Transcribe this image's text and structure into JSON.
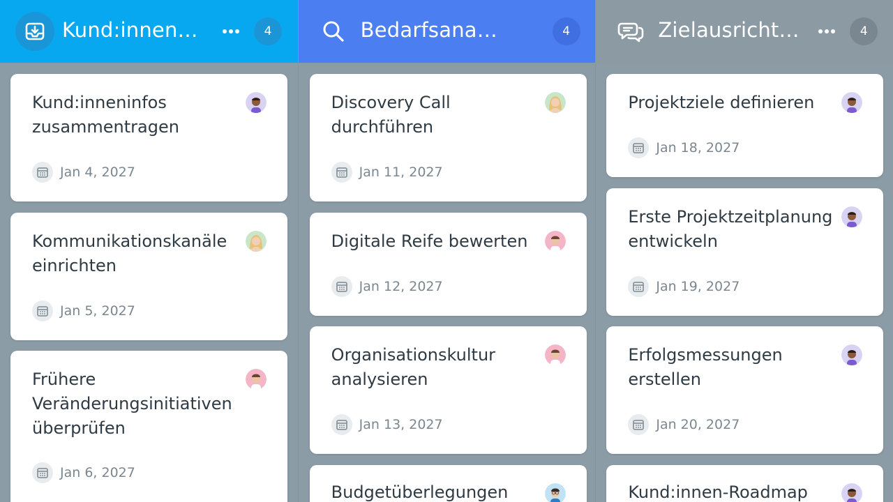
{
  "columns": [
    {
      "title": "Kund:innen…",
      "count": "4",
      "icon": "inbox-download-icon",
      "color": "#08a8f0",
      "cards": [
        {
          "title": "Kund:inneninfos zusammentragen",
          "date": "Jan 4, 2027",
          "avatar": "avatar-purple-man"
        },
        {
          "title": "Kommunikationskanäle einrichten",
          "date": "Jan 5, 2027",
          "avatar": "avatar-blonde-woman"
        },
        {
          "title": "Frühere Veränderungsinitiativen überprüfen",
          "date": "Jan 6, 2027",
          "avatar": "avatar-pink-man"
        }
      ]
    },
    {
      "title": "Bedarfsana…",
      "count": "4",
      "icon": "search-icon",
      "color": "#4b7ff1",
      "cards": [
        {
          "title": "Discovery Call durchführen",
          "date": "Jan 11, 2027",
          "avatar": "avatar-blonde-woman"
        },
        {
          "title": "Digitale Reife bewerten",
          "date": "Jan 12, 2027",
          "avatar": "avatar-pink-man"
        },
        {
          "title": "Organisationskultur analysieren",
          "date": "Jan 13, 2027",
          "avatar": "avatar-pink-man"
        },
        {
          "title": "Budgetüberlegungen",
          "date": "",
          "avatar": "avatar-blue-man"
        }
      ]
    },
    {
      "title": "Zielausricht…",
      "count": "4",
      "icon": "chat-bubbles-icon",
      "color": "#8c9aa3",
      "cards": [
        {
          "title": "Projektziele definieren",
          "date": "Jan 18, 2027",
          "avatar": "avatar-purple-man"
        },
        {
          "title": "Erste Projektzeitplanung entwickeln",
          "date": "Jan 19, 2027",
          "avatar": "avatar-purple-man"
        },
        {
          "title": "Erfolgsmessungen erstellen",
          "date": "Jan 20, 2027",
          "avatar": "avatar-purple-man"
        },
        {
          "title": "Kund:innen-Roadmap",
          "date": "",
          "avatar": "avatar-purple-man"
        }
      ]
    }
  ]
}
